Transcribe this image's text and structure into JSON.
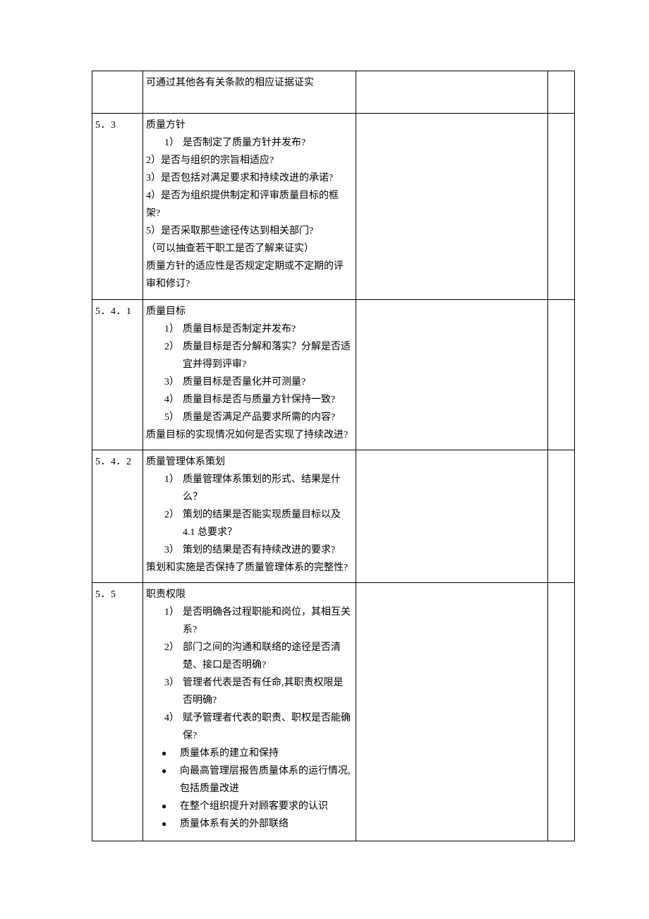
{
  "rows": [
    {
      "id": "",
      "body": [
        {
          "kind": "plain",
          "text": "可通过其他各有关条款的相应证据证实"
        }
      ]
    },
    {
      "id": "5．3",
      "body": [
        {
          "kind": "plain",
          "text": "质量方针"
        },
        {
          "kind": "num-indent",
          "marker": "1）",
          "text": "是否制定了质量方针并发布?"
        },
        {
          "kind": "plain",
          "text": "2）是否与组织的宗旨相适应?"
        },
        {
          "kind": "plain",
          "text": "3）是否包括对满足要求和持续改进的承诺?"
        },
        {
          "kind": "plain",
          "text": "4）是否为组织提供制定和评审质量目标的框架?"
        },
        {
          "kind": "plain",
          "text": "5）是否采取那些途径传达到相关部门?"
        },
        {
          "kind": "plain",
          "text": "（可以抽查若干职工是否了解来证实）"
        },
        {
          "kind": "plain",
          "text": "质量方针的适应性是否规定定期或不定期的评审和修订?"
        }
      ]
    },
    {
      "id": "5．4．1",
      "body": [
        {
          "kind": "plain",
          "text": "质量目标"
        },
        {
          "kind": "num-indent",
          "marker": "1）",
          "text": "质量目标是否制定并发布?"
        },
        {
          "kind": "num-indent",
          "marker": "2）",
          "text": "质量目标是否分解和落实？分解是否适宜并得到评审?"
        },
        {
          "kind": "num-indent",
          "marker": "3）",
          "text": "质量目标是否量化并可测量?"
        },
        {
          "kind": "num-indent",
          "marker": "4）",
          "text": "质量目标是否与质量方针保持一致?"
        },
        {
          "kind": "num-indent",
          "marker": "5）",
          "text": "质量是否满足产品要求所需的内容?"
        },
        {
          "kind": "plain",
          "text": "质量目标的实现情况如何是否实现了持续改进?"
        }
      ]
    },
    {
      "id": "5．4．2",
      "body": [
        {
          "kind": "plain",
          "text": "质量管理体系策划"
        },
        {
          "kind": "num-indent",
          "marker": "1）",
          "text": "质量管理体系策划的形式、结果是什么？"
        },
        {
          "kind": "num-indent",
          "marker": "2）",
          "text": "策划的结果是否能实现质量目标以及4.1 总要求？"
        },
        {
          "kind": "num-indent",
          "marker": "3）",
          "text": "策划的结果是否有持续改进的要求?"
        },
        {
          "kind": "plain",
          "text": "策划和实施是否保持了质量管理体系的完整性?"
        }
      ]
    },
    {
      "id": "5．5",
      "body": [
        {
          "kind": "plain",
          "text": "职责权限"
        },
        {
          "kind": "num-indent",
          "marker": "1）",
          "text": "是否明确各过程职能和岗位，其相互关系?"
        },
        {
          "kind": "num-indent",
          "marker": "2）",
          "text": "部门之间的沟通和联络的途径是否清楚、接口是否明确?"
        },
        {
          "kind": "num-indent",
          "marker": "3）",
          "text": "管理者代表是否有任命,其职责权限是否明确?"
        },
        {
          "kind": "num-indent",
          "marker": "4）",
          "text": "赋予管理者代表的职责、职权是否能确保?"
        },
        {
          "kind": "bullet",
          "marker": "●",
          "text": "质量体系的建立和保持"
        },
        {
          "kind": "bullet",
          "marker": "●",
          "text": "向最高管理层报告质量体系的运行情况,包括质量改进"
        },
        {
          "kind": "bullet",
          "marker": "●",
          "text": "在整个组织提升对顾客要求的认识"
        },
        {
          "kind": "bullet",
          "marker": "●",
          "text": "质量体系有关的外部联络"
        }
      ]
    }
  ]
}
